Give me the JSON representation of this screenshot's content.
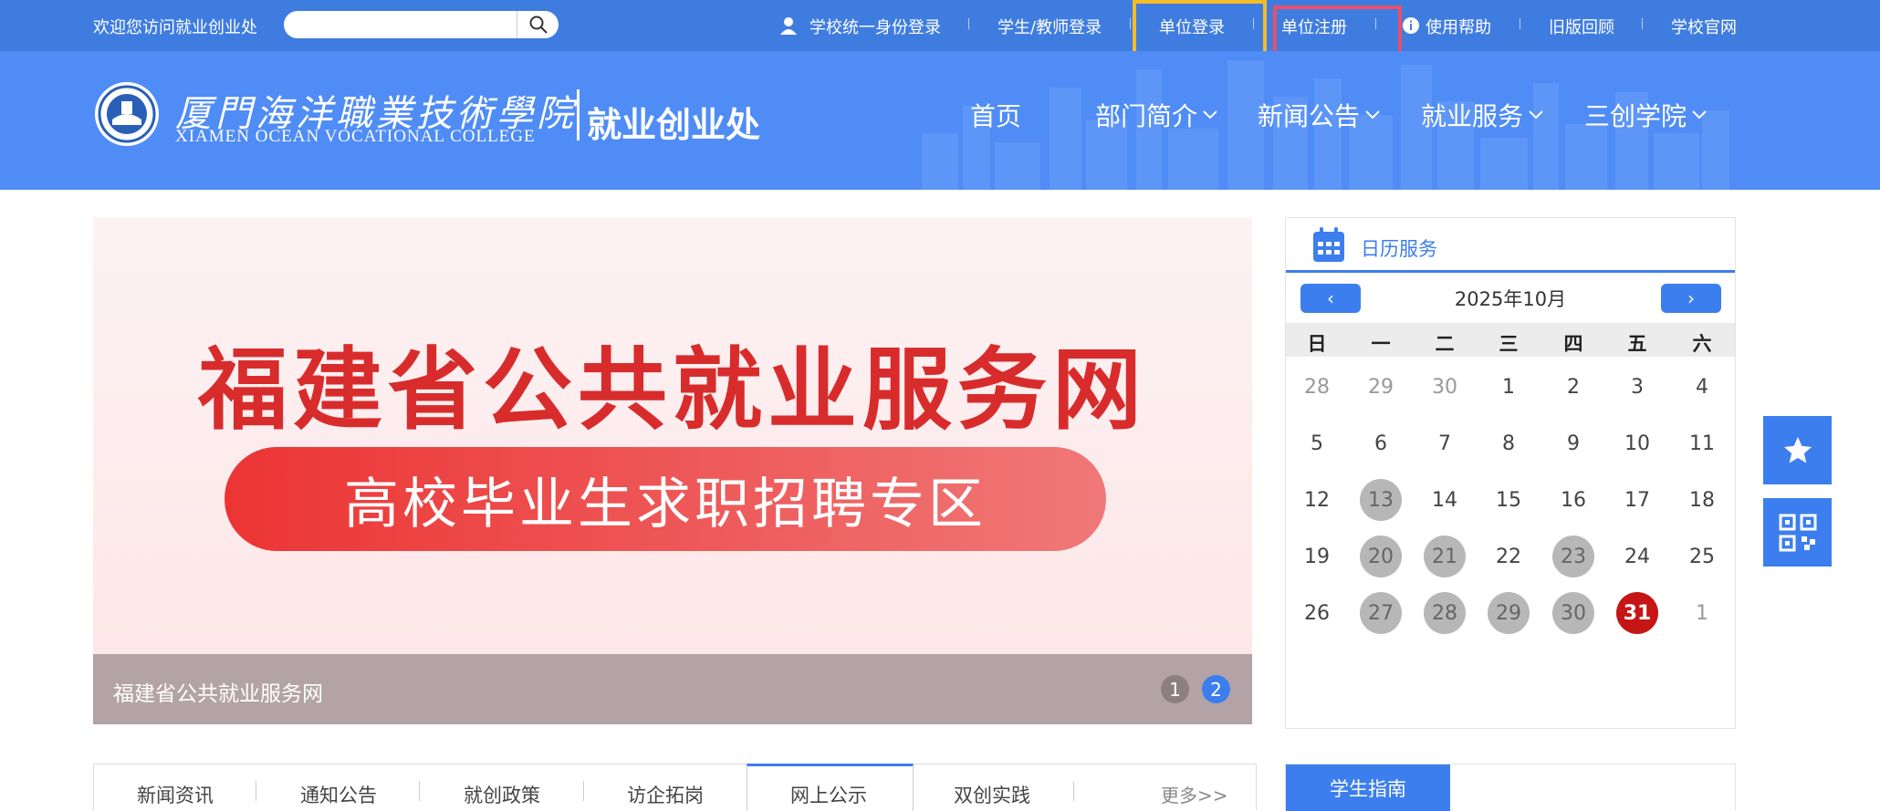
{
  "topbar": {
    "welcome": "欢迎您访问就业创业处",
    "search_placeholder": "",
    "links": {
      "sso": "学校统一身份登录",
      "student_teacher": "学生/教师登录",
      "unit_login": "单位登录",
      "unit_register": "单位注册",
      "help": "使用帮助",
      "old_version": "旧版回顾",
      "school_site": "学校官网"
    }
  },
  "header": {
    "school_cn": "厦門海洋職業技術學院",
    "school_en": "XIAMEN OCEAN VOCATIONAL COLLEGE",
    "dept": "就业创业处",
    "nav": {
      "home": "首页",
      "about": "部门简介",
      "news": "新闻公告",
      "services": "就业服务",
      "college": "三创学院"
    }
  },
  "banner": {
    "title": "福建省公共就业服务网",
    "subtitle": "高校毕业生求职招聘专区",
    "caption": "福建省公共就业服务网",
    "pager": [
      "1",
      "2"
    ],
    "active_page": 2
  },
  "calendar": {
    "title": "日历服务",
    "prev": "‹",
    "next": "›",
    "month": "2025年10月",
    "weekdays": [
      "日",
      "一",
      "二",
      "三",
      "四",
      "五",
      "六"
    ],
    "weeks": [
      [
        "28",
        "29",
        "30",
        "1",
        "2",
        "3",
        "4"
      ],
      [
        "5",
        "6",
        "7",
        "8",
        "9",
        "10",
        "11"
      ],
      [
        "12",
        "13",
        "14",
        "15",
        "16",
        "17",
        "18"
      ],
      [
        "19",
        "20",
        "21",
        "22",
        "23",
        "24",
        "25"
      ],
      [
        "26",
        "27",
        "28",
        "29",
        "30",
        "31",
        "1"
      ]
    ],
    "marked_days": [
      "13",
      "20",
      "21",
      "23",
      "27",
      "28",
      "29",
      "30"
    ],
    "today": "31",
    "accent_color": "#3c7eee",
    "today_color": "#c61515"
  },
  "tabs": {
    "items": [
      "新闻资讯",
      "通知公告",
      "就创政策",
      "访企拓岗",
      "网上公示",
      "双创实践"
    ],
    "active": "网上公示",
    "more": "更多>>"
  },
  "guide": {
    "tab": "学生指南"
  },
  "colors": {
    "topbar": "#3f7ce0",
    "header": "#4f8cf6",
    "highlight_yellow": "#f4bd27",
    "highlight_red": "#e8506a"
  }
}
